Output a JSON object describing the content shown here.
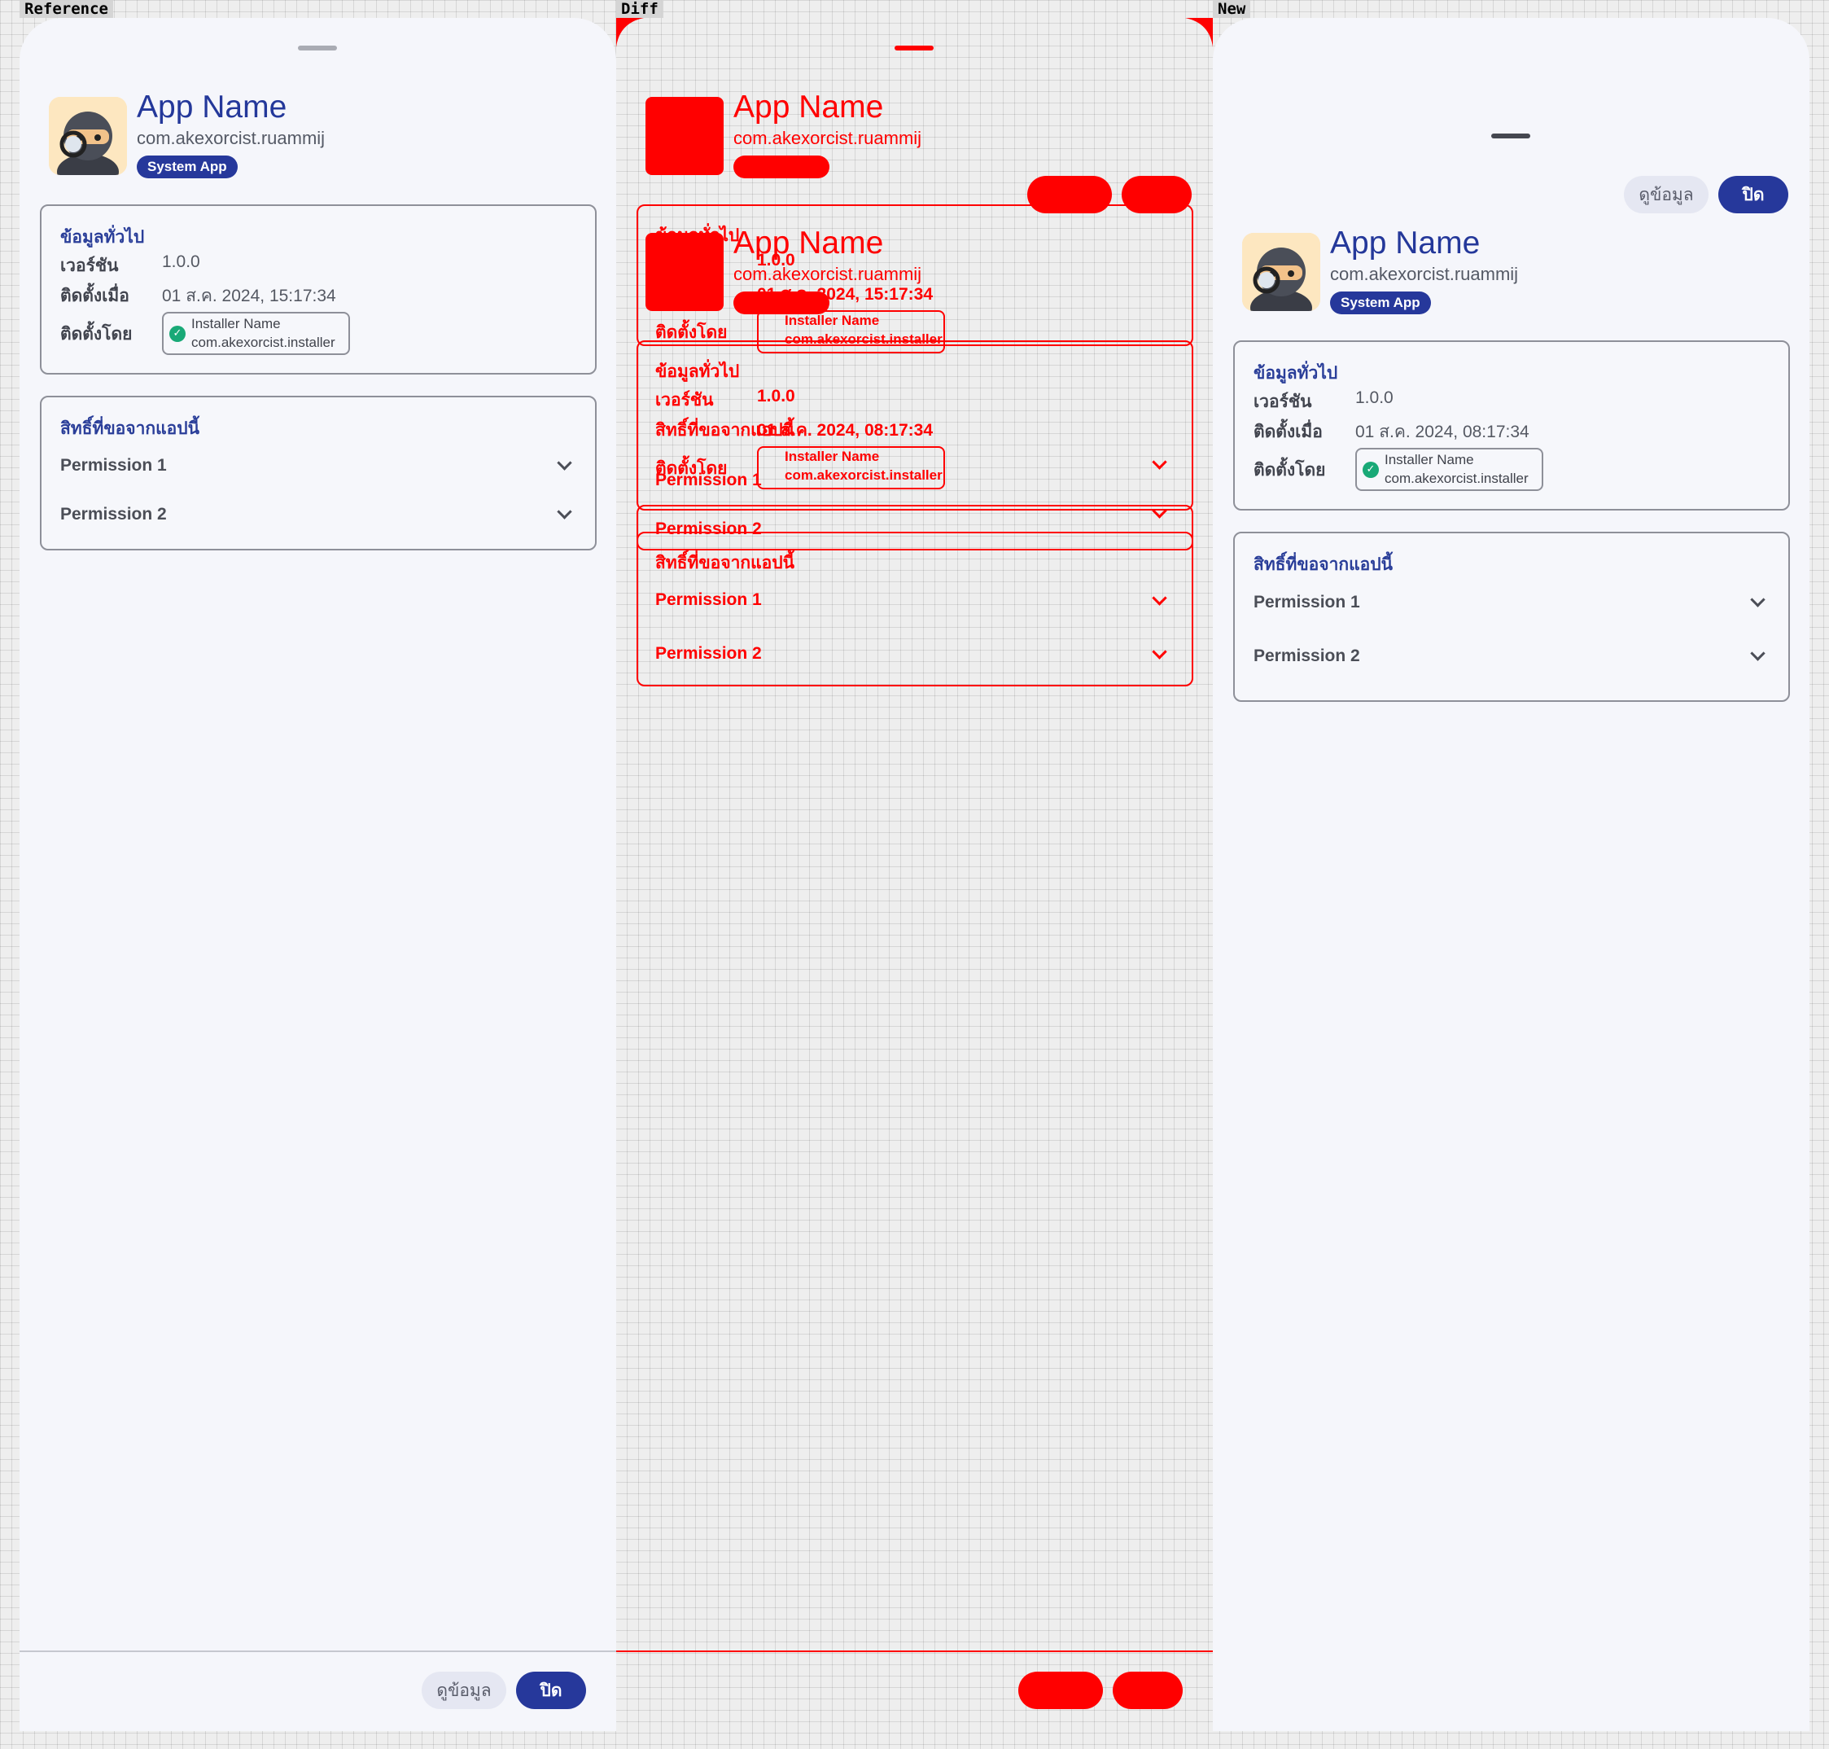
{
  "panels": {
    "reference": "Reference",
    "diff": "Diff",
    "new": "New"
  },
  "app": {
    "name": "App Name",
    "package": "com.akexorcist.ruammij",
    "badge": "System App",
    "icon": "ninja-detective-icon"
  },
  "general_info": {
    "title": "ข้อมูลทั่วไป",
    "version_label": "เวอร์ชัน",
    "version_value": "1.0.0",
    "installed_label": "ติดตั้งเมื่อ",
    "installed_value_reference": "01 ส.ค. 2024, 15:17:34",
    "installed_value_new": "01 ส.ค. 2024, 08:17:34",
    "installed_by_label": "ติดตั้งโดย",
    "installer_name": "Installer Name",
    "installer_package": "com.akexorcist.installer"
  },
  "permissions": {
    "title": "สิทธิ์ที่ขอจากแอปนี้",
    "items": [
      {
        "label": "Permission 1"
      },
      {
        "label": "Permission 2"
      }
    ]
  },
  "actions": {
    "details_label": "ดูข้อมูล",
    "close_label": "ปิด"
  },
  "colors": {
    "accent": "#26389b",
    "title": "#24389a",
    "check": "#19a977",
    "diff": "#ff0000",
    "sheet": "#f5f6fb"
  }
}
